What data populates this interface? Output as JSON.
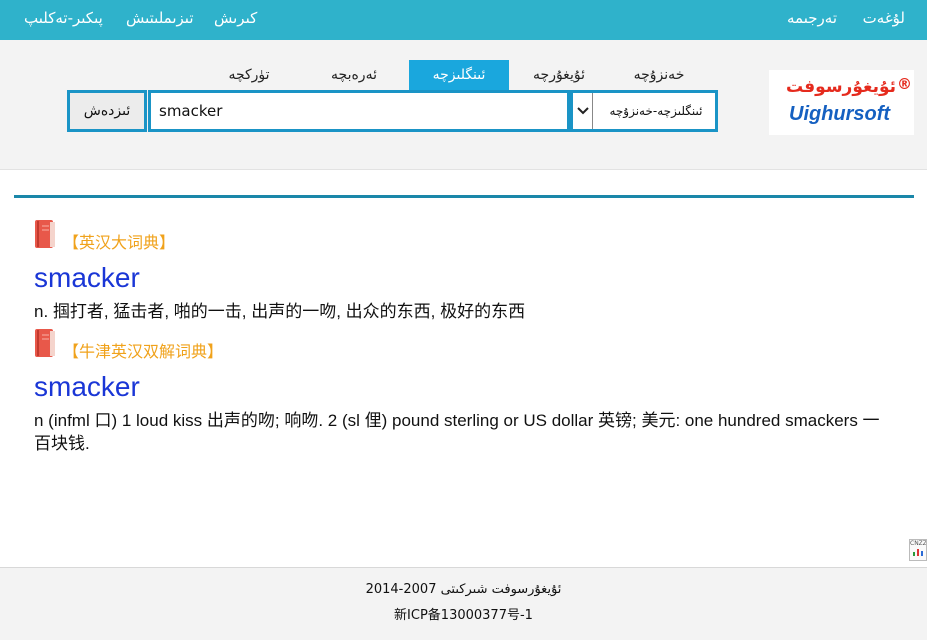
{
  "top_nav": {
    "right_links": [
      "لۇغەت",
      "تەرجىمە"
    ],
    "left_links": [
      "كىرىش",
      "تىزىملىتىش",
      "پىكىر-تەكلىپ"
    ]
  },
  "search": {
    "tabs": [
      "خەنزۇچە",
      "ئۇيغۇرچە",
      "ئىنگلىزچە",
      "ئەرەبچە",
      "تۈركچە"
    ],
    "active_tab": "ئىنگلىزچە",
    "button_label": "ئىزدەش",
    "query": "smacker",
    "direction": "ئىنگلىزچە-خەنزۇچە"
  },
  "logo": {
    "uyghur_text": "ئۇيغۇرسوفت",
    "registered_mark": "®",
    "english_text": "Uighursoft"
  },
  "results": [
    {
      "dictionary": "【英汉大词典】",
      "headword": "smacker",
      "definition": "n. 掴打者, 猛击者, 啪的一击, 出声的一吻, 出众的东西, 极好的东西"
    },
    {
      "dictionary": "【牛津英汉双解词典】",
      "headword": "smacker",
      "definition": "n (infml 口) 1 loud kiss 出声的吻; 响吻. 2 (sl 俚) pound sterling or US dollar 英镑; 美元: one hundred smackers 一百块钱."
    }
  ],
  "stat_badge": "CNZZ",
  "footer": {
    "copyright": "ئۇيغۇرسوفت شىركىتى 2007-2014",
    "icp": "新ICP备13000377号-1"
  },
  "colors": {
    "nav_bar": "#2fb2cb",
    "accent_blue": "#1a94c6",
    "headword": "#1a36d6",
    "dictionary_title": "#f0a21b",
    "logo_red": "#e52a1d",
    "logo_blue": "#1560c1"
  }
}
